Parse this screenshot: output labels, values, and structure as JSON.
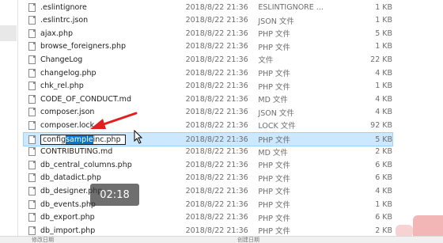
{
  "files": [
    {
      "name": ".eslintignore",
      "date": "2018/8/22 21:36",
      "type": "ESLINTIGNORE ...",
      "size": "1 KB"
    },
    {
      "name": ".eslintrc.json",
      "date": "2018/8/22 21:36",
      "type": "JSON 文件",
      "size": "1 KB"
    },
    {
      "name": "ajax.php",
      "date": "2018/8/22 21:36",
      "type": "PHP 文件",
      "size": "5 KB"
    },
    {
      "name": "browse_foreigners.php",
      "date": "2018/8/22 21:36",
      "type": "PHP 文件",
      "size": "1 KB"
    },
    {
      "name": "ChangeLog",
      "date": "2018/8/22 21:36",
      "type": "文件",
      "size": "22 KB"
    },
    {
      "name": "changelog.php",
      "date": "2018/8/22 21:36",
      "type": "PHP 文件",
      "size": "4 KB"
    },
    {
      "name": "chk_rel.php",
      "date": "2018/8/22 21:36",
      "type": "PHP 文件",
      "size": "1 KB"
    },
    {
      "name": "CODE_OF_CONDUCT.md",
      "date": "2018/8/22 21:36",
      "type": "MD 文件",
      "size": "4 KB"
    },
    {
      "name": "composer.json",
      "date": "2018/8/22 21:36",
      "type": "JSON 文件",
      "size": "4 KB"
    },
    {
      "name": "composer.lock",
      "date": "2018/8/22 21:36",
      "type": "LOCK 文件",
      "size": "92 KB"
    },
    {
      "name": "config.sample.inc.php",
      "date": "2018/8/22 21:36",
      "type": "PHP 文件",
      "size": "5 KB"
    },
    {
      "name": "CONTRIBUTING.md",
      "date": "2018/8/22 21:36",
      "type": "MD 文件",
      "size": "2 KB"
    },
    {
      "name": "db_central_columns.php",
      "date": "2018/8/22 21:36",
      "type": "PHP 文件",
      "size": "6 KB"
    },
    {
      "name": "db_datadict.php",
      "date": "2018/8/22 21:36",
      "type": "PHP 文件",
      "size": "6 KB"
    },
    {
      "name": "db_designer.php",
      "date": "2018/8/22 21:36",
      "type": "PHP 文件",
      "size": "4 KB"
    },
    {
      "name": "db_events.php",
      "date": "2018/8/22 21:36",
      "type": "PHP 文件",
      "size": "1 KB"
    },
    {
      "name": "db_export.php",
      "date": "2018/8/22 21:36",
      "type": "PHP 文件",
      "size": "6 KB"
    },
    {
      "name": "db_import.php",
      "date": "2018/8/22 21:36",
      "type": "PHP 文件",
      "size": "2 KB"
    }
  ],
  "rename": {
    "before": "config",
    "selected": "sample",
    "after": "inc.php"
  },
  "video_time": "02:18",
  "bottom_bar": {
    "modified_label": "修改日期",
    "created_label": "创建日期"
  }
}
